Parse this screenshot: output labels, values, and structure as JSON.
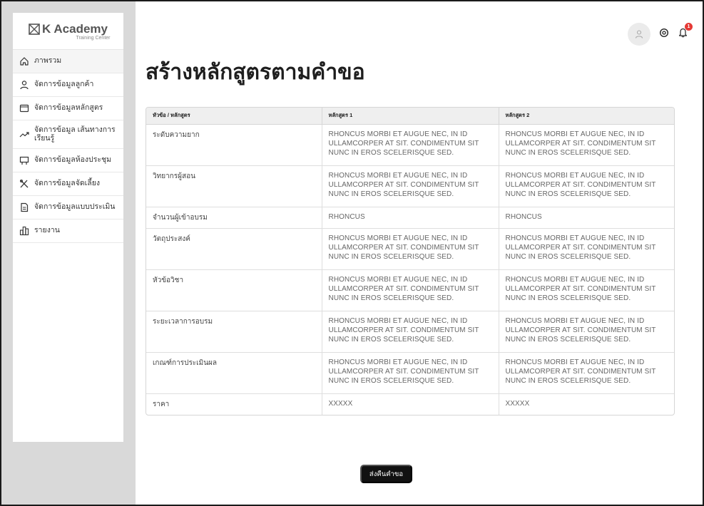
{
  "brand": {
    "name": "K Academy",
    "subtitle": "Training Center"
  },
  "sidebar": {
    "items": [
      {
        "label": "ภาพรวม",
        "icon": "home-icon"
      },
      {
        "label": "จัดการข้อมูลลูกค้า",
        "icon": "user-icon"
      },
      {
        "label": "จัดการข้อมูลหลักสูตร",
        "icon": "folder-icon"
      },
      {
        "label": "จัดการข้อมูล เส้นทางการเรียนรู้",
        "icon": "trend-icon"
      },
      {
        "label": "จัดการข้อมูลห้องประชุม",
        "icon": "meeting-room-icon"
      },
      {
        "label": "จัดการข้อมูลจัดเลี้ยง",
        "icon": "utensils-icon"
      },
      {
        "label": "จัดการข้อมูลแบบประเมิน",
        "icon": "document-icon"
      },
      {
        "label": "รายงาน",
        "icon": "report-icon"
      }
    ]
  },
  "header": {
    "notification_count": "1"
  },
  "page": {
    "title": "สร้างหลักสูตรตามคำขอ"
  },
  "table": {
    "headers": [
      "หัวข้อ / หลักสูตร",
      "หลักสูตร 1",
      "หลักสูตร 2"
    ],
    "rows": [
      {
        "label": "ระดับความยาก",
        "v1": "RHONCUS MORBI ET AUGUE NEC, IN ID ULLAMCORPER AT SIT. CONDIMENTUM SIT NUNC IN EROS SCELERISQUE SED.",
        "v2": "RHONCUS MORBI ET AUGUE NEC, IN ID ULLAMCORPER AT SIT. CONDIMENTUM SIT NUNC IN EROS SCELERISQUE SED."
      },
      {
        "label": "วิทยากรผู้สอน",
        "v1": "RHONCUS MORBI ET AUGUE NEC, IN ID ULLAMCORPER AT SIT. CONDIMENTUM SIT NUNC IN EROS SCELERISQUE SED.",
        "v2": "RHONCUS MORBI ET AUGUE NEC, IN ID ULLAMCORPER AT SIT. CONDIMENTUM SIT NUNC IN EROS SCELERISQUE SED."
      },
      {
        "label": "จำนวนผู้เข้าอบรม",
        "v1": "RHONCUS",
        "v2": "RHONCUS"
      },
      {
        "label": "วัตถุประสงค์",
        "v1": "RHONCUS MORBI ET AUGUE NEC, IN ID ULLAMCORPER AT SIT. CONDIMENTUM SIT NUNC IN EROS SCELERISQUE SED.",
        "v2": "RHONCUS MORBI ET AUGUE NEC, IN ID ULLAMCORPER AT SIT. CONDIMENTUM SIT NUNC IN EROS SCELERISQUE SED."
      },
      {
        "label": "หัวข้อวิชา",
        "v1": "RHONCUS MORBI ET AUGUE NEC, IN ID ULLAMCORPER AT SIT. CONDIMENTUM SIT NUNC IN EROS SCELERISQUE SED.",
        "v2": "RHONCUS MORBI ET AUGUE NEC, IN ID ULLAMCORPER AT SIT. CONDIMENTUM SIT NUNC IN EROS SCELERISQUE SED."
      },
      {
        "label": "ระยะเวลาการอบรม",
        "v1": "RHONCUS MORBI ET AUGUE NEC, IN ID ULLAMCORPER AT SIT. CONDIMENTUM SIT NUNC IN EROS SCELERISQUE SED.",
        "v2": "RHONCUS MORBI ET AUGUE NEC, IN ID ULLAMCORPER AT SIT. CONDIMENTUM SIT NUNC IN EROS SCELERISQUE SED."
      },
      {
        "label": "เกณฑ์การประเมินผล",
        "v1": "RHONCUS MORBI ET AUGUE NEC, IN ID ULLAMCORPER AT SIT. CONDIMENTUM SIT NUNC IN EROS SCELERISQUE SED.",
        "v2": "RHONCUS MORBI ET AUGUE NEC, IN ID ULLAMCORPER AT SIT. CONDIMENTUM SIT NUNC IN EROS SCELERISQUE SED."
      },
      {
        "label": "ราคา",
        "v1": "XXXXX",
        "v2": "XXXXX"
      }
    ]
  },
  "actions": {
    "submit_label": "ส่งคืนคำขอ"
  },
  "colors": {
    "sidebar_bg": "#d9d9d9",
    "button_bg": "#111111",
    "badge": "#e53935"
  }
}
